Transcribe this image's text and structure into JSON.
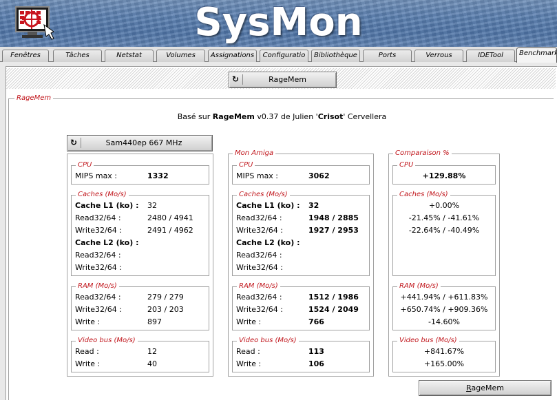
{
  "app": {
    "title": "SysMon"
  },
  "tabs": [
    {
      "label": "Fenêtres",
      "active": false
    },
    {
      "label": "Tâches",
      "active": false
    },
    {
      "label": "Netstat",
      "active": false
    },
    {
      "label": "Volumes",
      "active": false
    },
    {
      "label": "Assignations",
      "active": false
    },
    {
      "label": "Configuratio",
      "active": false
    },
    {
      "label": "Bibliothèque",
      "active": false
    },
    {
      "label": "Ports",
      "active": false
    },
    {
      "label": "Verrous",
      "active": false
    },
    {
      "label": "IDETool",
      "active": false
    },
    {
      "label": "Benchmark",
      "active": true
    }
  ],
  "toolbar": {
    "top_button_label": "RageMem",
    "top_button_icon": "refresh-icon"
  },
  "section": {
    "legend": "RageMem",
    "credit": {
      "prefix": "Basé sur ",
      "program": "RageMem",
      "middle": " v0.37 de Julien '",
      "nick": "Crisot",
      "suffix": "' Cervellera"
    },
    "machine_button": {
      "label": "Sam440ep 667 MHz",
      "icon": "refresh-icon"
    },
    "columns": {
      "ref": {
        "legend": "",
        "cpu": {
          "legend": "CPU",
          "label": "MIPS max :",
          "value": "1332"
        },
        "caches": {
          "legend": "Caches (Mo/s)",
          "l1_label": "Cache L1 (ko) :",
          "l1_value": "32",
          "read_label": "Read32/64 :",
          "read_value": "2480 / 4941",
          "write_label": "Write32/64 :",
          "write_value": "2491 / 4962",
          "l2_label": "Cache L2 (ko) :",
          "l2_value": "",
          "read2_label": "Read32/64 :",
          "read2_value": "",
          "write2_label": "Write32/64 :",
          "write2_value": ""
        },
        "ram": {
          "legend": "RAM (Mo/s)",
          "read_label": "Read32/64 :",
          "read_value": "279 / 279",
          "write_label": "Write32/64 :",
          "write_value": "203 / 203",
          "w_label": "Write :",
          "w_value": "897"
        },
        "video": {
          "legend": "Video bus (Mo/s)",
          "read_label": "Read :",
          "read_value": "12",
          "write_label": "Write :",
          "write_value": "40"
        }
      },
      "mine": {
        "legend": "Mon Amiga",
        "cpu": {
          "legend": "CPU",
          "label": "MIPS max :",
          "value": "3062"
        },
        "caches": {
          "legend": "Caches (Mo/s)",
          "l1_label": "Cache L1 (ko) :",
          "l1_value": "32",
          "read_label": "Read32/64 :",
          "read_value": "1948 / 2885",
          "write_label": "Write32/64 :",
          "write_value": "1927 / 2953",
          "l2_label": "Cache L2 (ko) :",
          "l2_value": "",
          "read2_label": "Read32/64 :",
          "read2_value": "",
          "write2_label": "Write32/64 :",
          "write2_value": ""
        },
        "ram": {
          "legend": "RAM (Mo/s)",
          "read_label": "Read32/64 :",
          "read_value": "1512 / 1986",
          "write_label": "Write32/64 :",
          "write_value": "1524 / 2049",
          "w_label": "Write :",
          "w_value": "766"
        },
        "video": {
          "legend": "Video bus (Mo/s)",
          "read_label": "Read :",
          "read_value": "113",
          "write_label": "Write :",
          "write_value": "106"
        }
      },
      "compare": {
        "legend": "Comparaison %",
        "cpu": {
          "legend": "CPU",
          "value": "+129.88%"
        },
        "caches": {
          "legend": "Caches (Mo/s)",
          "l1": "+0.00%",
          "read": "-21.45% / -41.61%",
          "write": "-22.64% / -40.49%"
        },
        "ram": {
          "legend": "RAM (Mo/s)",
          "read": "+441.94% / +611.83%",
          "write": "+650.74% / +909.36%",
          "w": "-14.60%"
        },
        "video": {
          "legend": "Video bus (Mo/s)",
          "read": "+841.67%",
          "write": "+165.00%"
        }
      }
    }
  },
  "bottom_button": {
    "label": "RageMem",
    "accel": "R",
    "rest": "ageMem"
  },
  "colors": {
    "legend_red": "#c0141a",
    "banner_blue": "#5a7fb0"
  }
}
